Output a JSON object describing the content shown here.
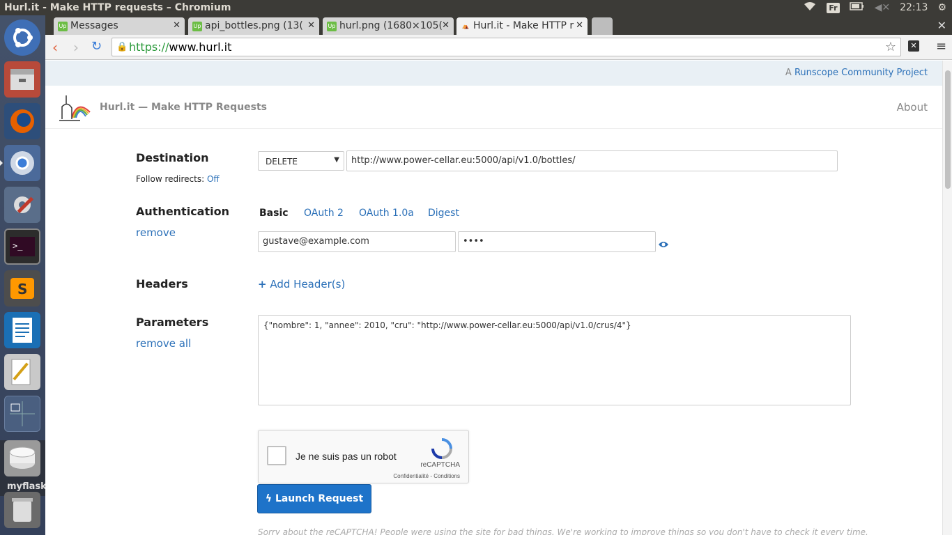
{
  "os": {
    "window_title": "Hurl.it - Make HTTP requests – Chromium",
    "keyboard_layout": "Fr",
    "clock": "22:13",
    "launcher_label": "myflask"
  },
  "tabs": [
    {
      "label": "Messages",
      "favicon": "Up"
    },
    {
      "label": "api_bottles.png (13(",
      "favicon": "Up"
    },
    {
      "label": "hurl.png (1680×105(",
      "favicon": "Up"
    },
    {
      "label": "Hurl.it - Make HTTP r",
      "favicon": ""
    }
  ],
  "address": {
    "scheme": "https://",
    "host": "www.hurl.it"
  },
  "page": {
    "community_prefix": "A",
    "community_link": "Runscope Community Project",
    "brand": "Hurl.it — Make HTTP Requests",
    "about": "About",
    "destination": {
      "label": "Destination",
      "follow_label": "Follow redirects:",
      "follow_value": "Off",
      "method": "DELETE",
      "url": "http://www.power-cellar.eu:5000/api/v1.0/bottles/"
    },
    "auth": {
      "label": "Authentication",
      "remove": "remove",
      "tabs": [
        "Basic",
        "OAuth 2",
        "OAuth 1.0a",
        "Digest"
      ],
      "username": "gustave@example.com",
      "password": "••••"
    },
    "headers": {
      "label": "Headers",
      "add": "Add Header(s)"
    },
    "parameters": {
      "label": "Parameters",
      "remove_all": "remove all",
      "body": "{\"nombre\": 1, \"annee\": 2010, \"cru\": \"http://www.power-cellar.eu:5000/api/v1.0/crus/4\"}"
    },
    "captcha": {
      "text": "Je ne suis pas un robot",
      "brand": "reCAPTCHA",
      "terms": "Confidentialité - Conditions"
    },
    "launch": "Launch Request",
    "note": "Sorry about the reCAPTCHA! People were using the site for bad things. We're working to improve things so you don't have to check it every time."
  }
}
